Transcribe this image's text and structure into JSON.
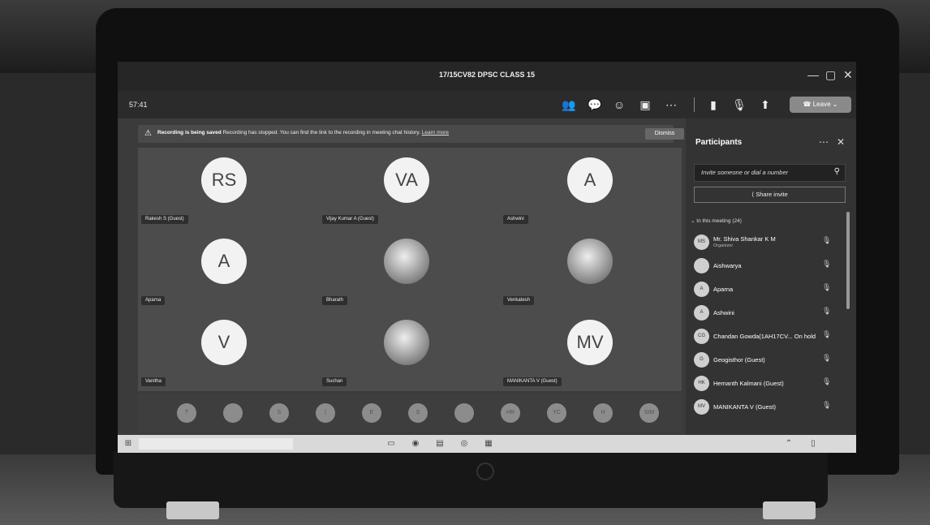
{
  "window": {
    "title": "17/15CV82 DPSC CLASS 15",
    "controls": [
      "—",
      "▢",
      "✕"
    ]
  },
  "toolbar": {
    "timer": "57:41",
    "icons": [
      "people-icon",
      "chat-icon",
      "reactions-icon",
      "rooms-icon",
      "more-icon",
      "camera-off-icon",
      "mic-icon",
      "share-tray-icon"
    ],
    "leave_label": "Leave"
  },
  "banner": {
    "bold": "Recording is being saved",
    "text": "Recording has stopped. You can find the link to the recording in meeting chat history.",
    "link": "Learn more",
    "dismiss_label": "Dismiss"
  },
  "stage": {
    "tiles": [
      {
        "initials": "RS",
        "name": "Rakesh S (Guest)",
        "photo": false
      },
      {
        "initials": "VA",
        "name": "Vijay Kumar A (Guest)",
        "photo": false
      },
      {
        "initials": "A",
        "name": "Ashwini",
        "photo": false
      },
      {
        "initials": "A",
        "name": "Aparna",
        "photo": false
      },
      {
        "initials": "",
        "name": "Bharath",
        "photo": true
      },
      {
        "initials": "",
        "name": "Venkatesh",
        "photo": true
      },
      {
        "initials": "V",
        "name": "Vanitha",
        "photo": false
      },
      {
        "initials": "",
        "name": "Suchan",
        "photo": true
      },
      {
        "initials": "MV",
        "name": "MANIKANTA V (Guest)",
        "photo": false
      }
    ]
  },
  "strip": {
    "avatars": [
      "T",
      "",
      "S",
      "(",
      "E",
      "S",
      "",
      "HR",
      "YC",
      "H",
      "SIM"
    ]
  },
  "participants": {
    "title": "Participants",
    "invite_placeholder": "Invite someone or dial a number",
    "share_invite_label": "Share invite",
    "section_label": "In this meeting (24)",
    "list": [
      {
        "initials": "MS",
        "name": "Mr. Shiva Shankar K M",
        "role": "Organizer"
      },
      {
        "initials": "",
        "name": "Aishwarya",
        "role": ""
      },
      {
        "initials": "A",
        "name": "Aparna",
        "role": ""
      },
      {
        "initials": "A",
        "name": "Ashwini",
        "role": ""
      },
      {
        "initials": "CG",
        "name": "Chandan Gowda(1AH17CV... On hold",
        "role": ""
      },
      {
        "initials": "G",
        "name": "Geogisthor (Guest)",
        "role": ""
      },
      {
        "initials": "HK",
        "name": "Hemanth Kalmani (Guest)",
        "role": ""
      },
      {
        "initials": "MV",
        "name": "MANIKANTA V (Guest)",
        "role": ""
      }
    ]
  },
  "colors": {
    "teams_dark": "#2b2b2b",
    "stage": "#4c4c4c",
    "panel": "#333333"
  }
}
